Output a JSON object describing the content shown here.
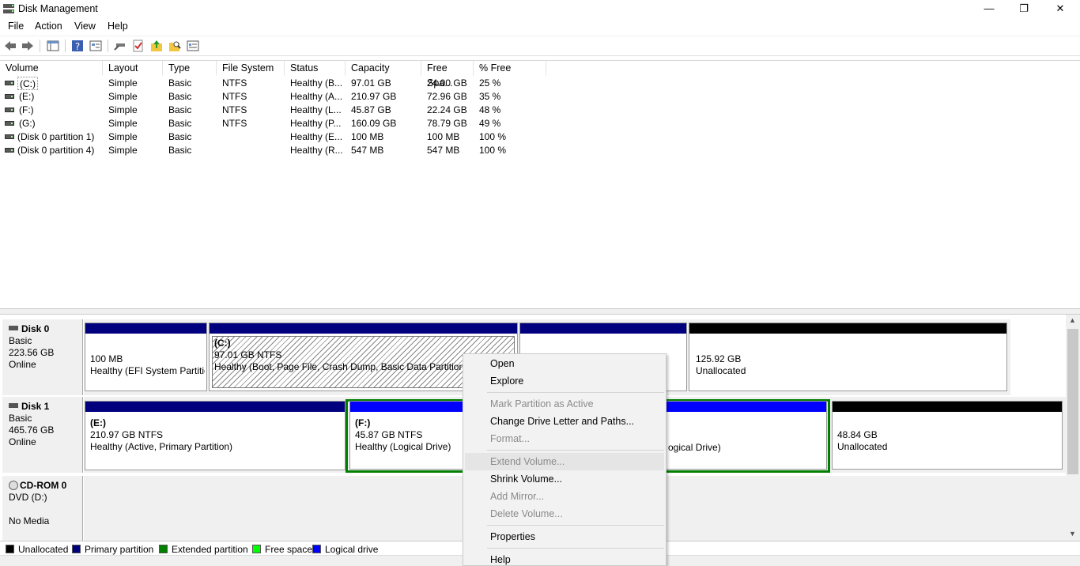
{
  "window": {
    "title": "Disk Management",
    "minimize": "—",
    "maximize": "❐",
    "close": "✕"
  },
  "menu": [
    "File",
    "Action",
    "View",
    "Help"
  ],
  "volume_list": {
    "columns": [
      "Volume",
      "Layout",
      "Type",
      "File System",
      "Status",
      "Capacity",
      "Free Spa...",
      "% Free"
    ],
    "rows": [
      [
        "(C:)",
        "Simple",
        "Basic",
        "NTFS",
        "Healthy (B...",
        "97.01 GB",
        "24.00 GB",
        "25 %"
      ],
      [
        "(E:)",
        "Simple",
        "Basic",
        "NTFS",
        "Healthy (A...",
        "210.97 GB",
        "72.96 GB",
        "35 %"
      ],
      [
        "(F:)",
        "Simple",
        "Basic",
        "NTFS",
        "Healthy (L...",
        "45.87 GB",
        "22.24 GB",
        "48 %"
      ],
      [
        "(G:)",
        "Simple",
        "Basic",
        "NTFS",
        "Healthy (P...",
        "160.09 GB",
        "78.79 GB",
        "49 %"
      ],
      [
        "(Disk 0 partition 1)",
        "Simple",
        "Basic",
        "",
        "Healthy (E...",
        "100 MB",
        "100 MB",
        "100 %"
      ],
      [
        "(Disk 0 partition 4)",
        "Simple",
        "Basic",
        "",
        "Healthy (R...",
        "547 MB",
        "547 MB",
        "100 %"
      ]
    ]
  },
  "disks": [
    {
      "name": "Disk 0",
      "type": "Basic",
      "size": "223.56 GB",
      "status": "Online"
    },
    {
      "name": "Disk 1",
      "type": "Basic",
      "size": "465.76 GB",
      "status": "Online"
    },
    {
      "name": "CD-ROM 0",
      "type": "DVD (D:)",
      "size": "",
      "status": "No Media"
    }
  ],
  "partitions": {
    "d0p1": {
      "line1": "",
      "line2": "100 MB",
      "line3": "Healthy (EFI System Partition)"
    },
    "d0p2": {
      "line1": "(C:)",
      "line2": "97.01 GB NTFS",
      "line3": "Healthy (Boot, Page File, Crash Dump, Basic Data Partition)"
    },
    "d0p4": {
      "line1": "",
      "line2": "125.92 GB",
      "line3": "Unallocated"
    },
    "d1p1": {
      "line1": "(E:)",
      "line2": "210.97 GB NTFS",
      "line3": "Healthy (Active, Primary Partition)"
    },
    "d1p2": {
      "line1": "(F:)",
      "line2": "45.87 GB NTFS",
      "line3": "Healthy (Logical Drive)"
    },
    "d1p3": {
      "line3": "ogical Drive)"
    },
    "d1p4": {
      "line1": "",
      "line2": "48.84 GB",
      "line3": "Unallocated"
    }
  },
  "legend": [
    {
      "label": "Unallocated",
      "color": "#000000"
    },
    {
      "label": "Primary partition",
      "color": "#00007f"
    },
    {
      "label": "Extended partition",
      "color": "#007f00"
    },
    {
      "label": "Free space",
      "color": "#00ff00"
    },
    {
      "label": "Logical drive",
      "color": "#0000ff"
    }
  ],
  "context_menu": {
    "open": "Open",
    "explore": "Explore",
    "mark_active": "Mark Partition as Active",
    "change_letter": "Change Drive Letter and Paths...",
    "format": "Format...",
    "extend": "Extend Volume...",
    "shrink": "Shrink Volume...",
    "add_mirror": "Add Mirror...",
    "delete": "Delete Volume...",
    "properties": "Properties",
    "help": "Help"
  }
}
